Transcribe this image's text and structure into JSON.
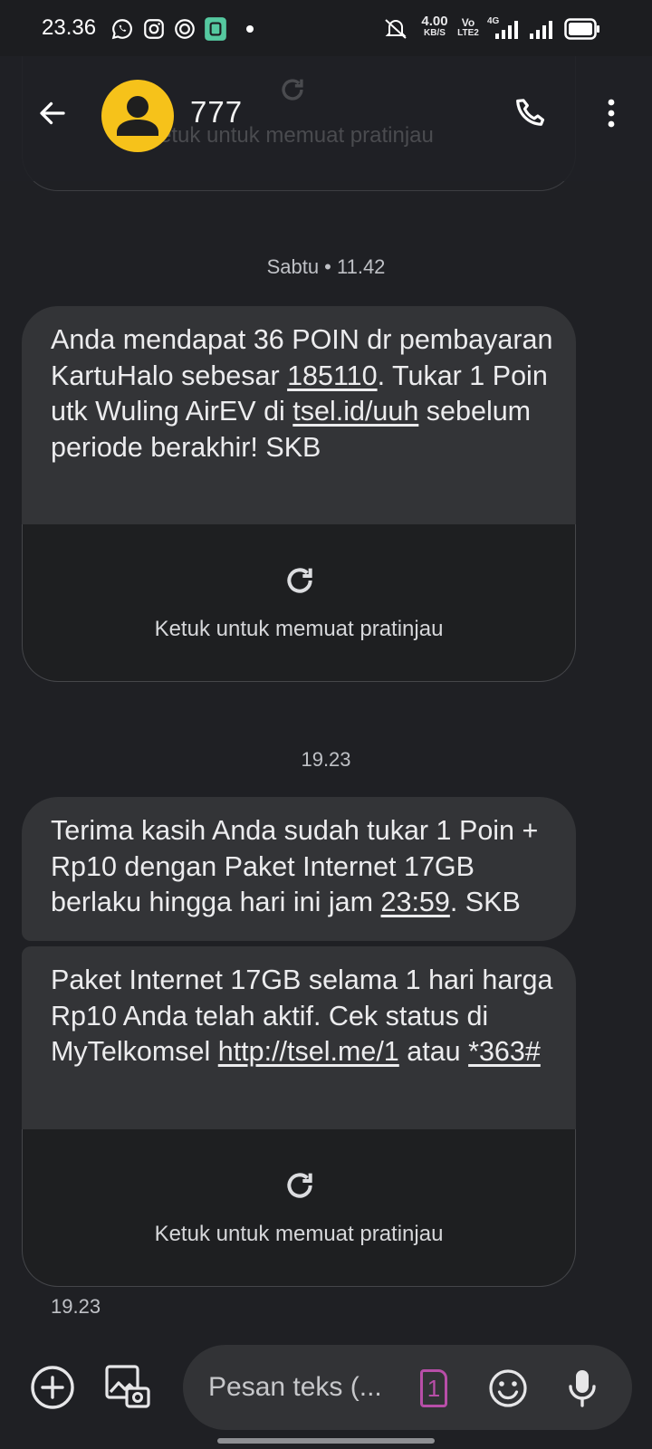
{
  "status_bar": {
    "time": "23.36",
    "net_speed_value": "4.00",
    "net_speed_unit": "KB/S",
    "volte_top": "Vo",
    "volte_bottom": "LTE2",
    "net_type": "4G",
    "notification_icons": [
      "whatsapp-icon",
      "instagram-icon",
      "threads-icon",
      "app-icon",
      "dot-icon"
    ],
    "system_icons": [
      "mute-icon",
      "signal-icon",
      "signal-icon",
      "battery-icon"
    ]
  },
  "header": {
    "contact_name": "777",
    "ghost_preview_text": "Ketuk untuk memuat pratinjau"
  },
  "messages": {
    "sep1": "Sabtu • 11.42",
    "m1": {
      "t1": "Anda mendapat 36 POIN dr pembayaran KartuHalo sebesar ",
      "link1": "185110",
      "t2": ". Tukar 1 Poin utk Wuling AirEV di ",
      "link2": "tsel.id/uuh",
      "t3": " sebelum periode berakhir! SKB"
    },
    "preview1": "Ketuk untuk memuat pratinjau",
    "sep2": "19.23",
    "m2": {
      "t1": "Terima kasih Anda sudah tukar 1 Poin + Rp10 dengan Paket Internet 17GB berlaku hingga hari ini jam ",
      "link1": "23:59",
      "t2": ". SKB"
    },
    "m3": {
      "t1": "Paket Internet 17GB selama 1 hari harga Rp10 Anda telah aktif. Cek status di MyTelkomsel ",
      "link1": "http://tsel.me/1",
      "t2": " atau ",
      "link2": "*363#"
    },
    "preview2": "Ketuk untuk memuat pratinjau",
    "footer_time": "19.23"
  },
  "composer": {
    "placeholder": "Pesan teks (...",
    "sim_number": "1"
  },
  "colors": {
    "background": "#1f2024",
    "bubble": "#333437",
    "avatar": "#f6c21a",
    "sim_accent": "#b84ea8"
  }
}
